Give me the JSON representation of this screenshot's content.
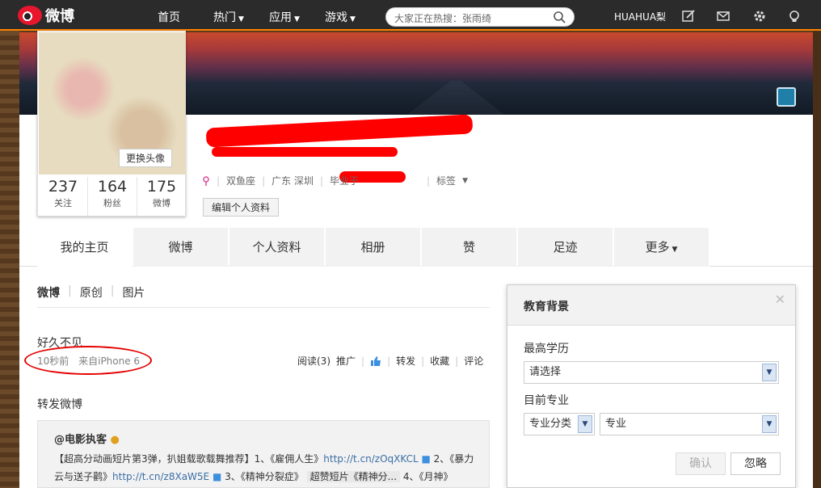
{
  "nav": {
    "logo_text": "微博",
    "items": [
      {
        "label": "首页",
        "has_caret": false
      },
      {
        "label": "热门",
        "has_caret": true
      },
      {
        "label": "应用",
        "has_caret": true
      },
      {
        "label": "游戏",
        "has_caret": true
      }
    ],
    "search_placeholder": "大家正在热搜：张雨绮",
    "user_name": "HUAHUA梨",
    "icons": [
      "edit-icon",
      "mail-icon",
      "gear-icon",
      "bulb-icon"
    ]
  },
  "profile": {
    "avatar_button": "更换头像",
    "stats": [
      {
        "num": "237",
        "label": "关注"
      },
      {
        "num": "164",
        "label": "粉丝"
      },
      {
        "num": "175",
        "label": "微博"
      }
    ],
    "info": {
      "constellation": "双鱼座",
      "location": "广东 深圳",
      "school_prefix": "毕业于",
      "tags": "标签"
    },
    "edit_button": "编辑个人资料"
  },
  "tabs": [
    "我的主页",
    "微博",
    "个人资料",
    "相册",
    "赞",
    "足迹",
    "更多"
  ],
  "feed": {
    "filters": [
      "微博",
      "原创",
      "图片"
    ],
    "post": {
      "text": "好久不见",
      "time": "10秒前",
      "source": "来自iPhone 6",
      "actions": {
        "read": "阅读(3)",
        "promote": "推广",
        "repost": "转发",
        "favorite": "收藏",
        "comment": "评论"
      }
    },
    "repost_title": "转发微博",
    "repost": {
      "author": "@电影执客",
      "line1_text": "【超高分动画短片第3弹，扒姐载歌载舞推荐】1、《雇佣人生》",
      "link1": "http://t.cn/zOqXKCL",
      "line1_after": "2、《暴力",
      "line2_text": "云与送子鹳》",
      "link2": "http://t.cn/z8XaW5E",
      "line2_mid": "3、《精神分裂症》",
      "line2_video": "超赞短片《精神分...",
      "line2_after": "4、《月神》"
    }
  },
  "popup": {
    "title": "教育背景",
    "label_degree": "最高学历",
    "degree_value": "请选择",
    "label_major": "目前专业",
    "major_category": "专业分类",
    "major_value": "专业",
    "confirm": "确认",
    "ignore": "忽略"
  },
  "colors": {
    "accent": "#ff8200",
    "highlight_circle": "#e60000",
    "link": "#3b6ea5"
  }
}
